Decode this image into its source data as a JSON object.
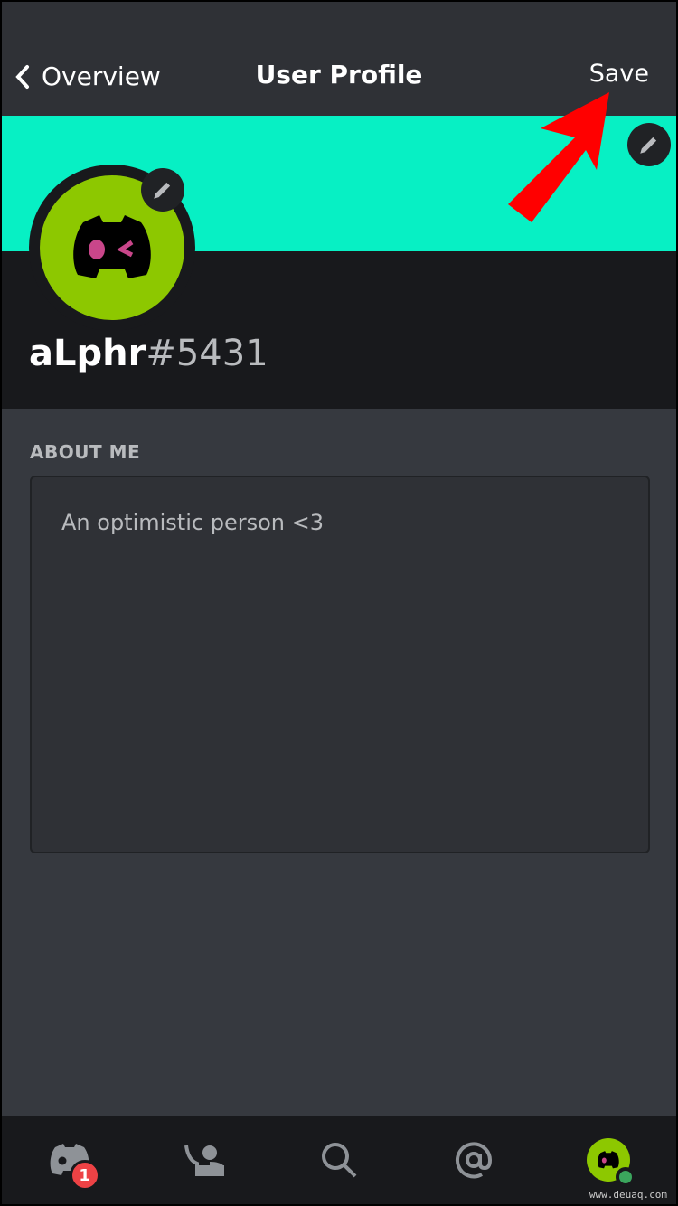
{
  "header": {
    "back_label": "Overview",
    "title": "User Profile",
    "save_label": "Save"
  },
  "profile": {
    "username": "aLphr",
    "discriminator": "#5431",
    "banner_color": "#07f0c4",
    "avatar_color": "#8dc800"
  },
  "about": {
    "label": "ABOUT ME",
    "text": "An optimistic person <3"
  },
  "nav": {
    "items": [
      {
        "icon": "discord-home-icon",
        "badge": "1"
      },
      {
        "icon": "friends-icon"
      },
      {
        "icon": "search-icon"
      },
      {
        "icon": "mentions-icon"
      },
      {
        "icon": "profile-avatar-icon",
        "status": "online"
      }
    ]
  },
  "annotation": {
    "arrow_color": "#ff0000"
  },
  "watermark": "www.deuaq.com"
}
